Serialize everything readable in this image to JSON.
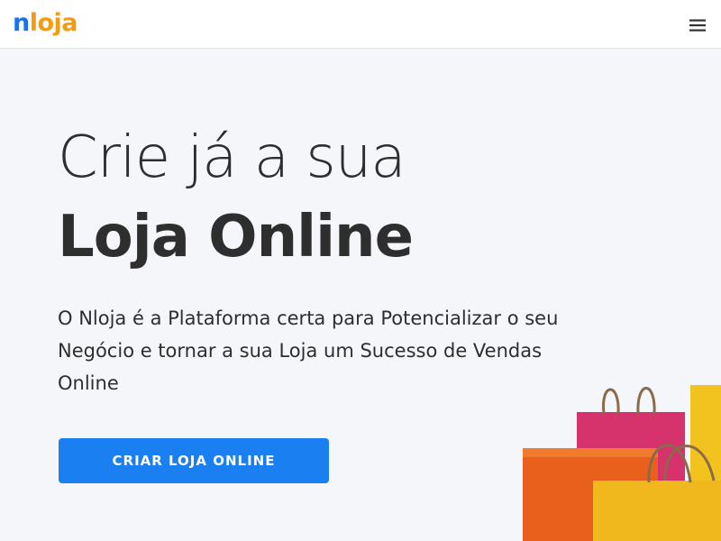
{
  "header": {
    "logo_first": "n",
    "logo_rest": "loja",
    "menu_icon": "hamburger-menu-icon"
  },
  "hero": {
    "title_line1": "Crie já a sua",
    "title_line2": "Loja Online",
    "description": "O Nloja é a Plataforma certa para Potencializar o seu Negócio e tornar a sua Loja um Sucesso de Vendas Online",
    "cta_label": "CRIAR LOJA ONLINE",
    "illustration": "shopping-bags-icon"
  },
  "colors": {
    "brand_blue": "#1a73e8",
    "brand_orange": "#f39c12",
    "cta_blue": "#1a7ff0",
    "hero_bg": "#f5f6fa"
  }
}
